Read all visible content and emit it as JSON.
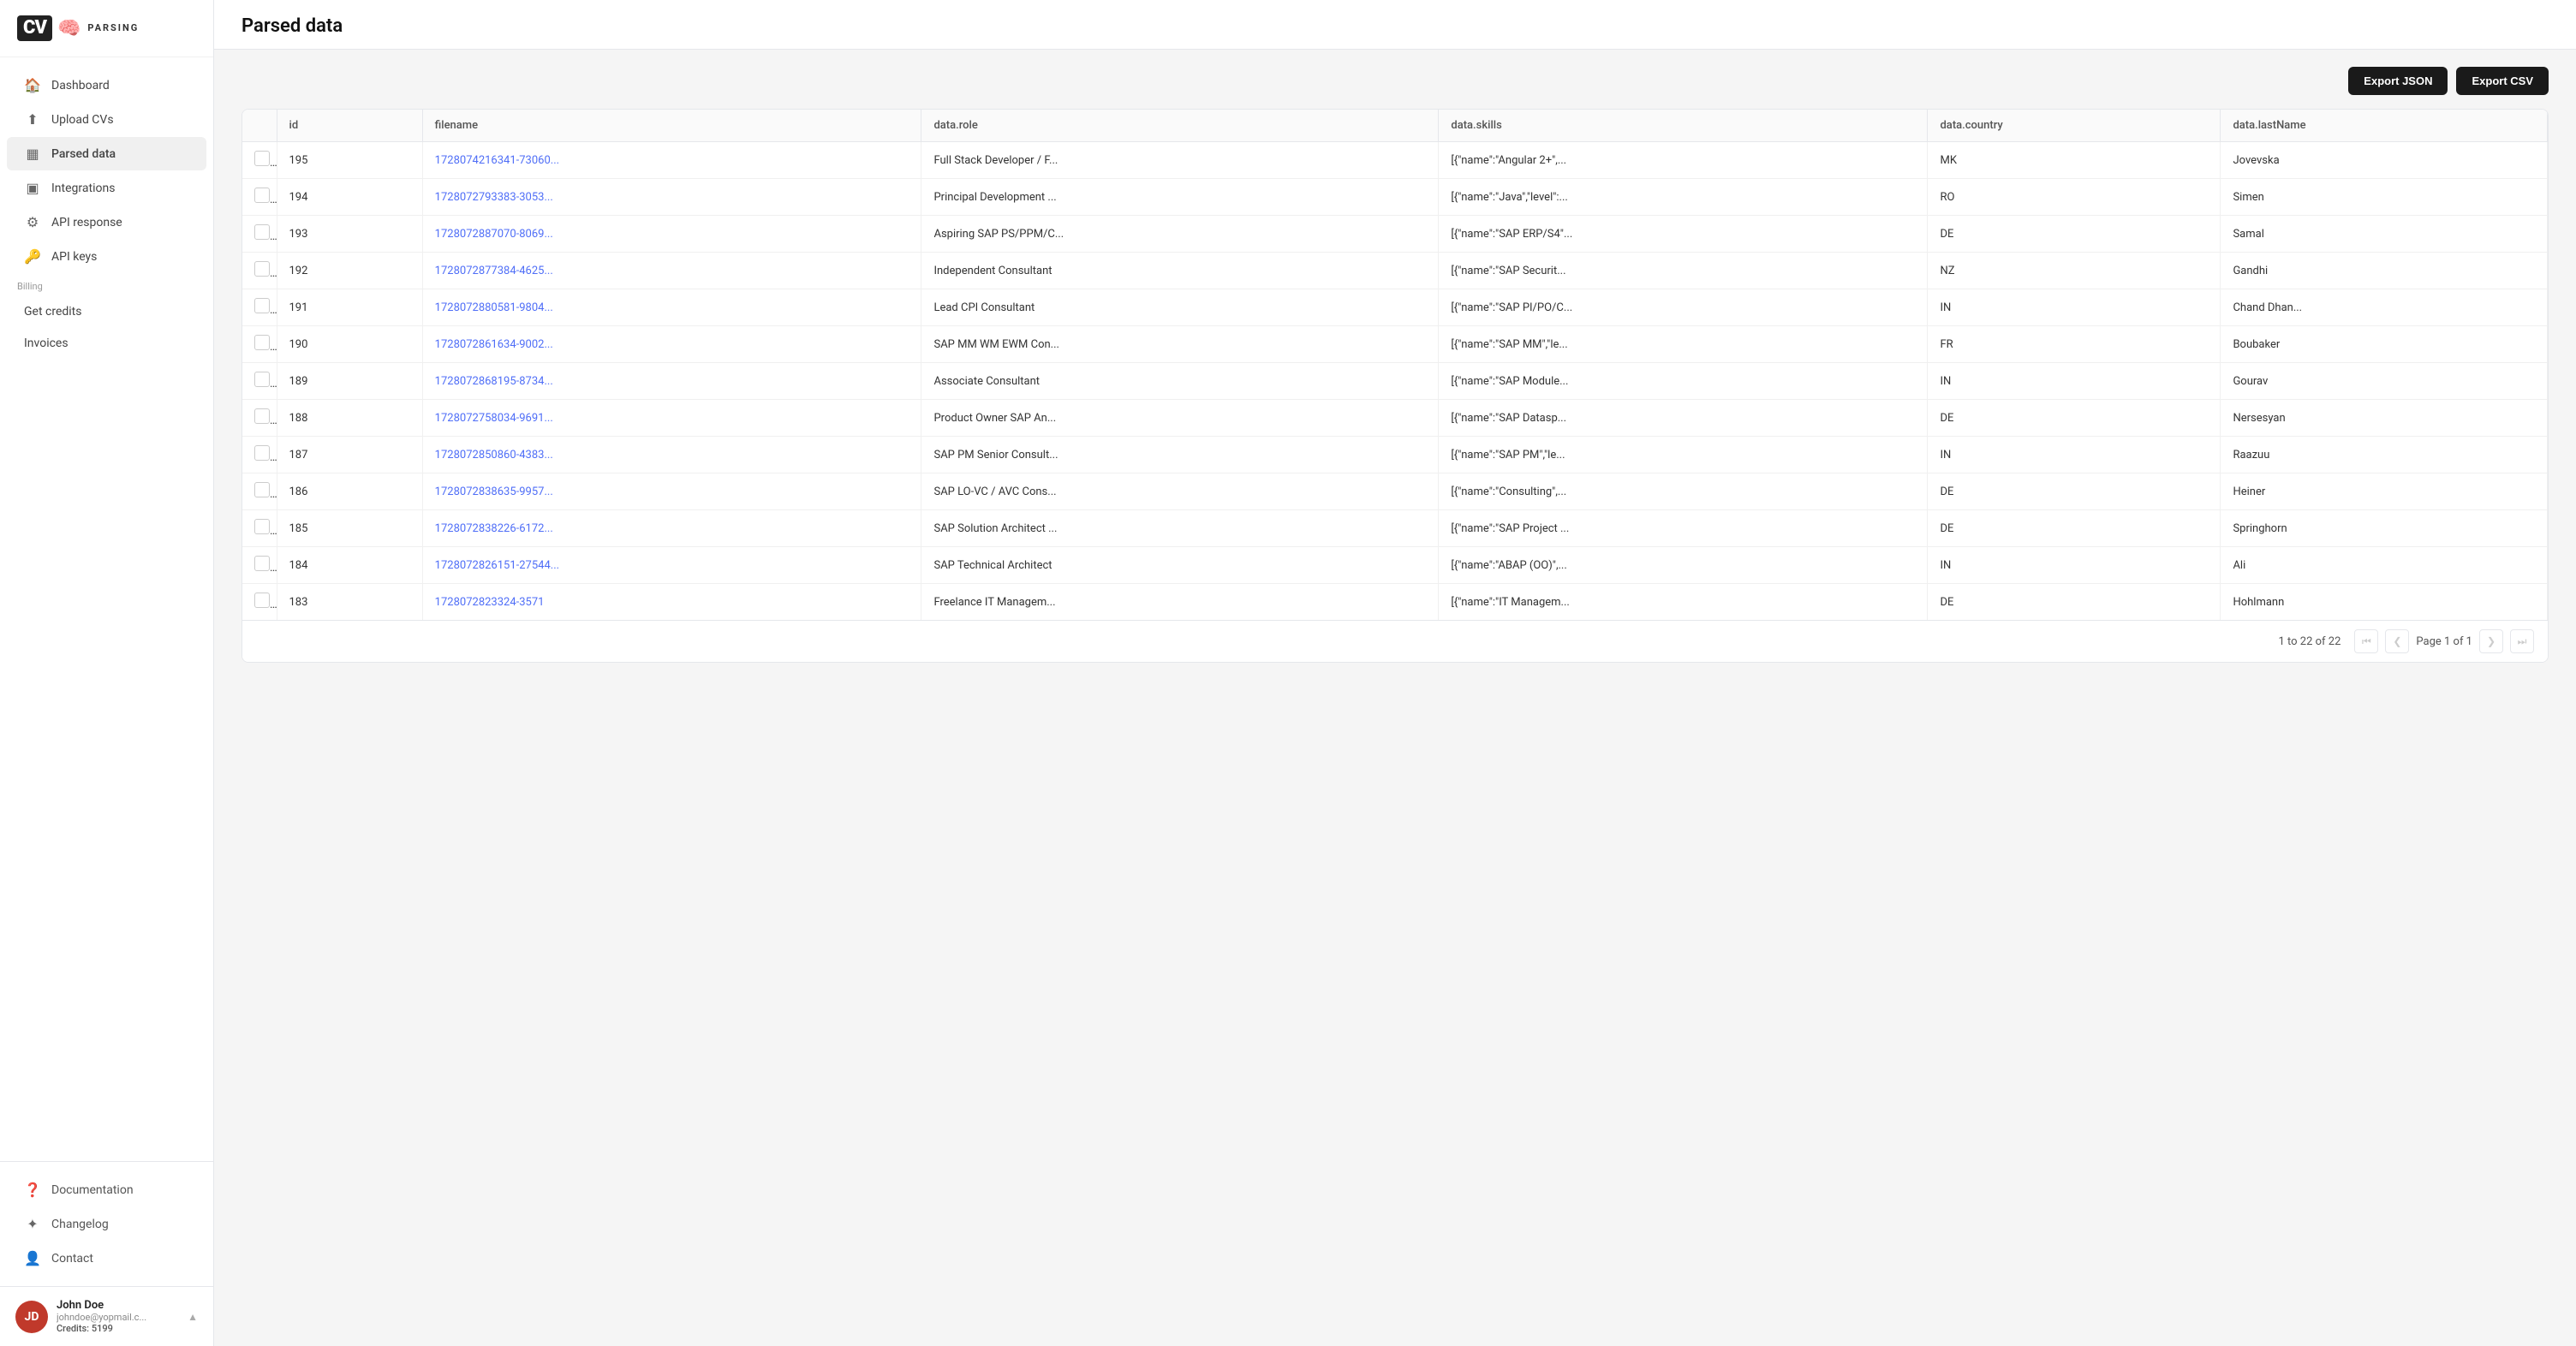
{
  "app": {
    "name": "CV PARSING",
    "logo_initials": "CV"
  },
  "sidebar": {
    "nav_items": [
      {
        "id": "dashboard",
        "label": "Dashboard",
        "icon": "🏠"
      },
      {
        "id": "upload-cvs",
        "label": "Upload CVs",
        "icon": "⬆"
      },
      {
        "id": "parsed-data",
        "label": "Parsed data",
        "icon": "▦",
        "active": true
      },
      {
        "id": "integrations",
        "label": "Integrations",
        "icon": "▣"
      },
      {
        "id": "api-response",
        "label": "API response",
        "icon": "⚙"
      },
      {
        "id": "api-keys",
        "label": "API keys",
        "icon": "🔑"
      }
    ],
    "billing_label": "Billing",
    "billing_items": [
      {
        "id": "get-credits",
        "label": "Get credits"
      },
      {
        "id": "invoices",
        "label": "Invoices"
      }
    ],
    "bottom_items": [
      {
        "id": "documentation",
        "label": "Documentation",
        "icon": "❓"
      },
      {
        "id": "changelog",
        "label": "Changelog",
        "icon": "✦"
      },
      {
        "id": "contact",
        "label": "Contact",
        "icon": "👤"
      }
    ],
    "user": {
      "name": "John Doe",
      "email": "johndoe@yopmail.c...",
      "credits_label": "Credits: 5199",
      "initials": "JD"
    }
  },
  "main": {
    "title": "Parsed data",
    "toolbar": {
      "export_json": "Export JSON",
      "export_csv": "Export CSV"
    },
    "table": {
      "columns": [
        "id",
        "filename",
        "data.role",
        "data.skills",
        "data.country",
        "data.lastName"
      ],
      "rows": [
        {
          "id": "195",
          "filename": "1728074216341-73060...",
          "role": "Full Stack Developer / F...",
          "skills": "[{\"name\":\"Angular 2+\",...",
          "country": "MK",
          "lastName": "Jovevska"
        },
        {
          "id": "194",
          "filename": "1728072793383-3053...",
          "role": "Principal Development ...",
          "skills": "[{\"name\":\"Java\",\"level\":...",
          "country": "RO",
          "lastName": "Simen"
        },
        {
          "id": "193",
          "filename": "1728072887070-8069...",
          "role": "Aspiring SAP PS/PPM/C...",
          "skills": "[{\"name\":\"SAP ERP/S4\"...",
          "country": "DE",
          "lastName": "Samal"
        },
        {
          "id": "192",
          "filename": "1728072877384-4625...",
          "role": "Independent Consultant",
          "skills": "[{\"name\":\"SAP Securit...",
          "country": "NZ",
          "lastName": "Gandhi"
        },
        {
          "id": "191",
          "filename": "1728072880581-9804...",
          "role": "Lead CPI Consultant",
          "skills": "[{\"name\":\"SAP PI/PO/C...",
          "country": "IN",
          "lastName": "Chand Dhan..."
        },
        {
          "id": "190",
          "filename": "1728072861634-9002...",
          "role": "SAP MM WM EWM Con...",
          "skills": "[{\"name\":\"SAP MM\",\"le...",
          "country": "FR",
          "lastName": "Boubaker"
        },
        {
          "id": "189",
          "filename": "1728072868195-8734...",
          "role": "Associate Consultant",
          "skills": "[{\"name\":\"SAP Module...",
          "country": "IN",
          "lastName": "Gourav"
        },
        {
          "id": "188",
          "filename": "1728072758034-9691...",
          "role": "Product Owner SAP An...",
          "skills": "[{\"name\":\"SAP Datasp...",
          "country": "DE",
          "lastName": "Nersesyan"
        },
        {
          "id": "187",
          "filename": "1728072850860-4383...",
          "role": "SAP PM Senior Consult...",
          "skills": "[{\"name\":\"SAP PM\",\"le...",
          "country": "IN",
          "lastName": "Raazuu"
        },
        {
          "id": "186",
          "filename": "1728072838635-9957...",
          "role": "SAP LO-VC / AVC Cons...",
          "skills": "[{\"name\":\"Consulting\",...",
          "country": "DE",
          "lastName": "Heiner"
        },
        {
          "id": "185",
          "filename": "1728072838226-6172...",
          "role": "SAP Solution Architect ...",
          "skills": "[{\"name\":\"SAP Project ...",
          "country": "DE",
          "lastName": "Springhorn"
        },
        {
          "id": "184",
          "filename": "1728072826151-27544...",
          "role": "SAP Technical Architect",
          "skills": "[{\"name\":\"ABAP (OO)\",...",
          "country": "IN",
          "lastName": "Ali"
        },
        {
          "id": "183",
          "filename": "1728072823324-3571",
          "role": "Freelance IT Managem...",
          "skills": "[{\"name\":\"IT Managem...",
          "country": "DE",
          "lastName": "Hohlmann"
        }
      ]
    },
    "pagination": {
      "range": "1 to 22 of 22",
      "page_label": "Page 1 of 1"
    }
  }
}
